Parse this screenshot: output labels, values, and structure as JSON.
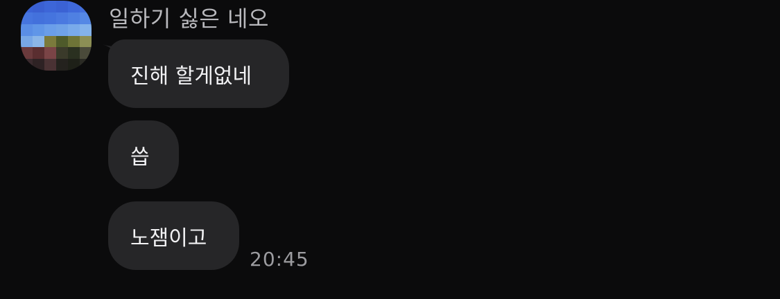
{
  "chat": {
    "sender_name": "일하기 싫은 네오",
    "messages": [
      {
        "text": "진해 할게없네"
      },
      {
        "text": "씁"
      },
      {
        "text": "노잼이고"
      }
    ],
    "timestamp": "20:45"
  },
  "colors": {
    "background": "#0b0b0c",
    "bubble": "#262628",
    "bubble_text": "#f2f2f4",
    "sender_name": "#b9b9bd",
    "timestamp": "#9c9ca0"
  },
  "avatar": {
    "icon": "pixelated-profile-photo"
  }
}
